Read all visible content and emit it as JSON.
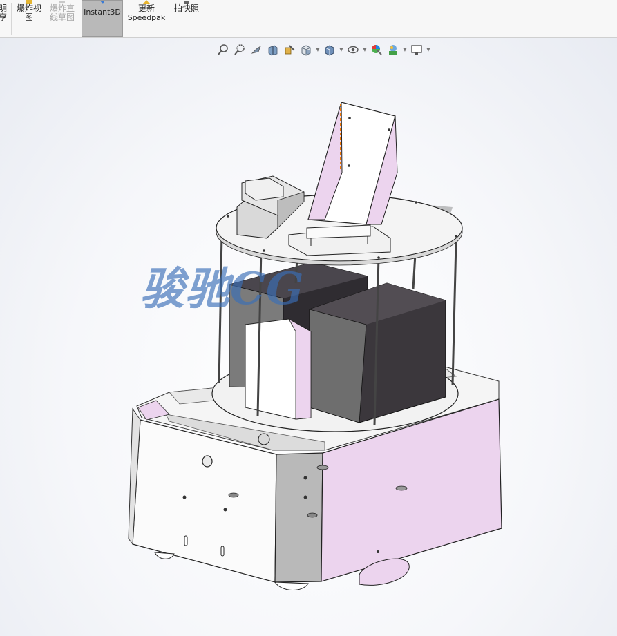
{
  "ribbon": {
    "partial_left": {
      "l1": "明",
      "l2": "享"
    },
    "exploded_view": {
      "l1": "爆炸视",
      "l2": "图"
    },
    "explode_line_sketch": {
      "l1": "爆炸直",
      "l2": "线草图"
    },
    "instant3d": {
      "l1": "Instant3D"
    },
    "update_speedpak": {
      "l1": "更新",
      "l2": "Speedpak"
    },
    "take_snapshot": {
      "l1": "拍快照"
    }
  },
  "heads_up_toolbar": [
    "zoom-to-fit-icon",
    "zoom-to-area-icon",
    "previous-view-icon",
    "section-view-icon",
    "dynamic-annotation-icon",
    "view-orientation-icon",
    "display-style-icon",
    "hide-show-items-icon",
    "edit-appearance-icon",
    "apply-scene-icon",
    "view-settings-icon"
  ],
  "watermark": {
    "text": "骏驰CG"
  },
  "colors": {
    "accent_pink": "#ecd4ee",
    "plate": "#f4f4f4",
    "dark_box": "#3b373c",
    "ribbon_bg": "#f7f7f7",
    "watermark": "#3a6fb8"
  }
}
